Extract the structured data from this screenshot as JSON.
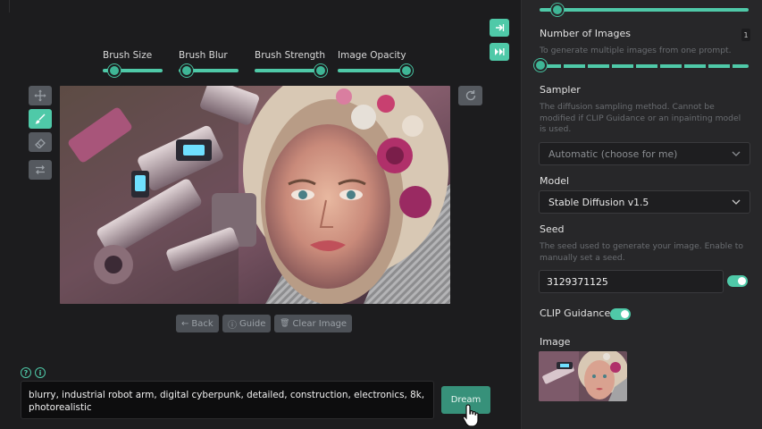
{
  "brush_controls": [
    {
      "label": "Brush Size",
      "level_percent": 20
    },
    {
      "label": "Brush Blur",
      "level_percent": 14
    },
    {
      "label": "Brush Strength",
      "level_percent": 100
    },
    {
      "label": "Image Opacity",
      "level_percent": 100
    }
  ],
  "tools": [
    {
      "name": "move-icon",
      "active": false
    },
    {
      "name": "brush-icon",
      "active": true
    },
    {
      "name": "eraser-icon",
      "active": false
    },
    {
      "name": "swap-icon",
      "active": false
    }
  ],
  "image_actions": {
    "back_label": "Back",
    "guide_label": "Guide",
    "clear_label": "Clear Image"
  },
  "prompt": {
    "text": "blurry, industrial robot arm, digital cyberpunk, detailed, construction, electronics, 8k, photorealistic"
  },
  "dream_label": "Dream",
  "panel": {
    "number_of_images": {
      "label": "Number of Images",
      "description": "To generate multiple images from one prompt.",
      "value": "1"
    },
    "sampler": {
      "label": "Sampler",
      "description": "The diffusion sampling method. Cannot be modified if CLIP Guidance or an inpainting model is used.",
      "selected": "Automatic (choose for me)"
    },
    "model": {
      "label": "Model",
      "selected": "Stable Diffusion v1.5"
    },
    "seed": {
      "label": "Seed",
      "description": "The seed used to generate your image. Enable to manually set a seed.",
      "value": "3129371125",
      "enabled": true
    },
    "clip_guidance": {
      "label": "CLIP Guidance",
      "enabled": true
    },
    "image": {
      "label": "Image"
    }
  },
  "colors": {
    "accent": "#4fc9a8",
    "dream_button": "#37917a",
    "panel_bg": "#272729",
    "workspace_bg": "#1c1c1e"
  }
}
